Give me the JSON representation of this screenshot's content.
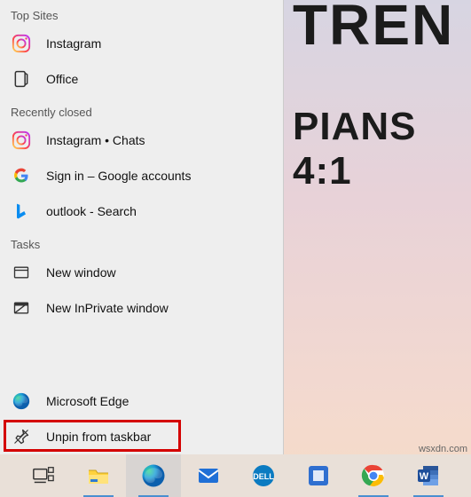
{
  "wallpaper": {
    "line1": "TREN",
    "line2": "PIANS 4:1"
  },
  "watermark": "wsxdn.com",
  "jumplist": {
    "sections": {
      "top_sites": {
        "header": "Top Sites",
        "items": [
          {
            "label": "Instagram",
            "icon": "instagram-icon"
          },
          {
            "label": "Office",
            "icon": "office-icon"
          }
        ]
      },
      "recently_closed": {
        "header": "Recently closed",
        "items": [
          {
            "label": "Instagram • Chats",
            "icon": "instagram-icon"
          },
          {
            "label": "Sign in – Google accounts",
            "icon": "google-icon"
          },
          {
            "label": "outlook - Search",
            "icon": "bing-icon"
          }
        ]
      },
      "tasks": {
        "header": "Tasks",
        "items": [
          {
            "label": "New window",
            "icon": "window-icon"
          },
          {
            "label": "New InPrivate window",
            "icon": "inprivate-icon"
          }
        ]
      },
      "footer": {
        "items": [
          {
            "label": "Microsoft Edge",
            "icon": "edge-icon"
          },
          {
            "label": "Unpin from taskbar",
            "icon": "unpin-icon"
          }
        ]
      }
    }
  },
  "taskbar": {
    "items": [
      {
        "name": "task-view",
        "active": false
      },
      {
        "name": "file-explorer",
        "active": false
      },
      {
        "name": "microsoft-edge",
        "active": true
      },
      {
        "name": "mail",
        "active": false
      },
      {
        "name": "dell",
        "active": false
      },
      {
        "name": "ms-store",
        "active": false
      },
      {
        "name": "google-chrome",
        "active": false
      },
      {
        "name": "microsoft-word",
        "active": false
      }
    ]
  }
}
